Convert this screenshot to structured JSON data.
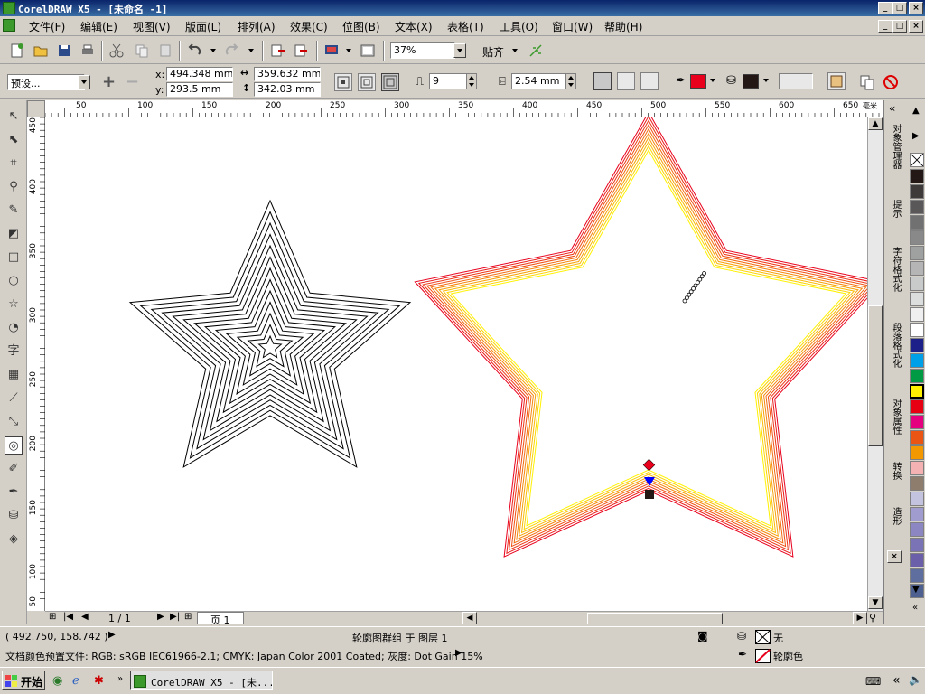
{
  "window": {
    "title": "CorelDRAW X5 - [未命名 -1]"
  },
  "menu": [
    "文件(F)",
    "编辑(E)",
    "视图(V)",
    "版面(L)",
    "排列(A)",
    "效果(C)",
    "位图(B)",
    "文本(X)",
    "表格(T)",
    "工具(O)",
    "窗口(W)",
    "帮助(H)"
  ],
  "toolbar": {
    "zoom": "37%",
    "align_label": "贴齐"
  },
  "property_bar": {
    "preset": "预设...",
    "x_label": "x:",
    "x_value": "494.348 mm",
    "y_label": "y:",
    "y_value": "293.5 mm",
    "width_value": "359.632 mm",
    "height_value": "342.03 mm",
    "steps": "9",
    "offset": "2.54 mm",
    "outline_color": "#e8001c",
    "fill_color": "#231815"
  },
  "rulers": {
    "h_labels": [
      "50",
      "100",
      "150",
      "200",
      "250",
      "300",
      "350",
      "400",
      "450",
      "500",
      "550",
      "600",
      "650"
    ],
    "h_unit": "毫米",
    "v_labels": [
      "400",
      "350",
      "300",
      "250",
      "200",
      "150",
      "100",
      "50"
    ],
    "v_top_label": "450"
  },
  "page_nav": {
    "page_count": "1 / 1",
    "page_tab": "页 1"
  },
  "dockers": [
    "对象管理器",
    "提示",
    "字符格式化",
    "段落格式化",
    "对象属性",
    "转换",
    "造形"
  ],
  "palette": [
    "#231815",
    "#3e3a39",
    "#595757",
    "#727171",
    "#898989",
    "#9fa0a0",
    "#b5b5b6",
    "#c9caca",
    "#dcdddd",
    "#efefef",
    "#ffffff",
    "#1d2088",
    "#00a0e9",
    "#009944",
    "#fff100",
    "#e60012",
    "#e4007f",
    "#ea5514",
    "#f39800",
    "#f5b2b2",
    "#8e7d6c",
    "#c3c3e0",
    "#a09cd0",
    "#8c86c2",
    "#7a73b5",
    "#6a5fa8",
    "#5e6e9e",
    "#4d6090"
  ],
  "status": {
    "coords": "( 492.750, 158.742 )",
    "selection": "轮廓图群组 于 图层 1",
    "fill_label": "无",
    "outline_label": "轮廓色",
    "profile": "文档颜色预置文件: RGB: sRGB IEC61966-2.1; CMYK: Japan Color 2001 Coated; 灰度: Dot Gain 15%"
  },
  "taskbar": {
    "start": "开始",
    "task": "CorelDRAW X5 - [未..."
  },
  "stars": {
    "left": {
      "color": "#000000",
      "steps": 9
    },
    "right": {
      "outer_color": "#e8001c",
      "inner_color": "#fff100",
      "steps": 9
    }
  }
}
